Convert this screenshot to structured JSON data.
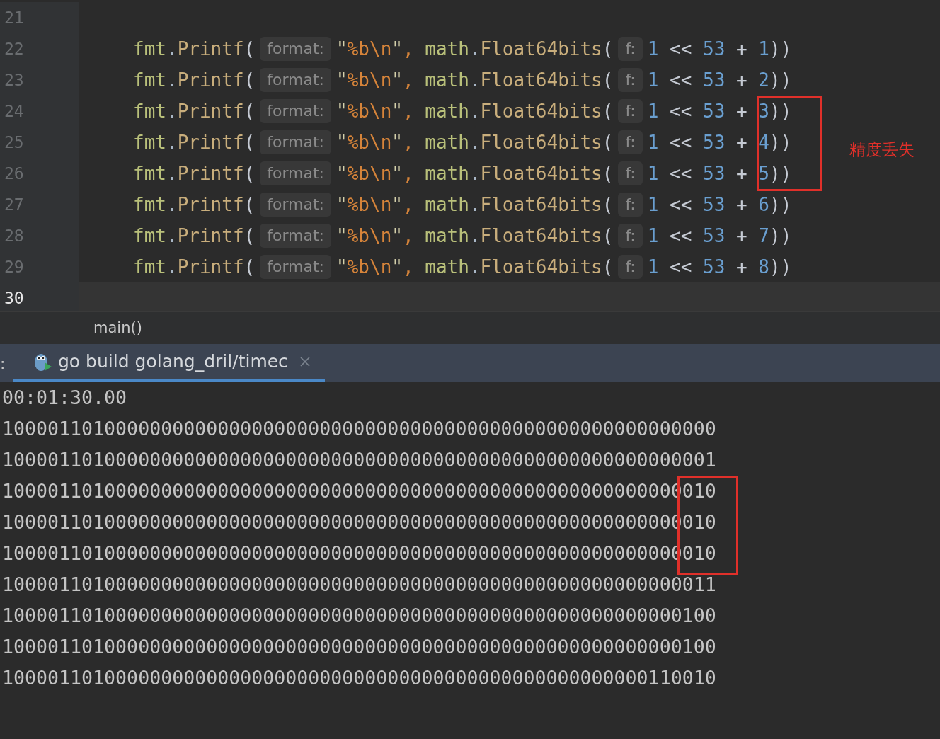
{
  "editor": {
    "code_lines": [
      {
        "number": "21",
        "current": false
      },
      {
        "number": "22",
        "current": false,
        "tokens": [
          {
            "kind": "pkg",
            "text": "fmt"
          },
          {
            "kind": "punct",
            "text": "."
          },
          {
            "kind": "func",
            "text": "Printf"
          },
          {
            "kind": "paren",
            "text": "("
          },
          {
            "kind": "hint",
            "text": "format:"
          },
          {
            "kind": "quote",
            "text": "\""
          },
          {
            "kind": "escape",
            "text": "%b\\n"
          },
          {
            "kind": "quote",
            "text": "\""
          },
          {
            "kind": "comma",
            "text": ", "
          },
          {
            "kind": "pkg",
            "text": "math"
          },
          {
            "kind": "punct",
            "text": "."
          },
          {
            "kind": "func",
            "text": "Float64bits"
          },
          {
            "kind": "paren",
            "text": "("
          },
          {
            "kind": "hint",
            "text": "f:"
          },
          {
            "kind": "number",
            "text": "1"
          },
          {
            "kind": "op",
            "text": " << "
          },
          {
            "kind": "number",
            "text": "53"
          },
          {
            "kind": "op",
            "text": " + "
          },
          {
            "kind": "number",
            "text": "1"
          },
          {
            "kind": "paren",
            "text": "))"
          }
        ]
      },
      {
        "number": "23",
        "current": false,
        "tokens": [
          {
            "kind": "pkg",
            "text": "fmt"
          },
          {
            "kind": "punct",
            "text": "."
          },
          {
            "kind": "func",
            "text": "Printf"
          },
          {
            "kind": "paren",
            "text": "("
          },
          {
            "kind": "hint",
            "text": "format:"
          },
          {
            "kind": "quote",
            "text": "\""
          },
          {
            "kind": "escape",
            "text": "%b\\n"
          },
          {
            "kind": "quote",
            "text": "\""
          },
          {
            "kind": "comma",
            "text": ", "
          },
          {
            "kind": "pkg",
            "text": "math"
          },
          {
            "kind": "punct",
            "text": "."
          },
          {
            "kind": "func",
            "text": "Float64bits"
          },
          {
            "kind": "paren",
            "text": "("
          },
          {
            "kind": "hint",
            "text": "f:"
          },
          {
            "kind": "number",
            "text": "1"
          },
          {
            "kind": "op",
            "text": " << "
          },
          {
            "kind": "number",
            "text": "53"
          },
          {
            "kind": "op",
            "text": " + "
          },
          {
            "kind": "number",
            "text": "2"
          },
          {
            "kind": "paren",
            "text": "))"
          }
        ]
      },
      {
        "number": "24",
        "current": false,
        "tokens": [
          {
            "kind": "pkg",
            "text": "fmt"
          },
          {
            "kind": "punct",
            "text": "."
          },
          {
            "kind": "func",
            "text": "Printf"
          },
          {
            "kind": "paren",
            "text": "("
          },
          {
            "kind": "hint",
            "text": "format:"
          },
          {
            "kind": "quote",
            "text": "\""
          },
          {
            "kind": "escape",
            "text": "%b\\n"
          },
          {
            "kind": "quote",
            "text": "\""
          },
          {
            "kind": "comma",
            "text": ", "
          },
          {
            "kind": "pkg",
            "text": "math"
          },
          {
            "kind": "punct",
            "text": "."
          },
          {
            "kind": "func",
            "text": "Float64bits"
          },
          {
            "kind": "paren",
            "text": "("
          },
          {
            "kind": "hint",
            "text": "f:"
          },
          {
            "kind": "number",
            "text": "1"
          },
          {
            "kind": "op",
            "text": " << "
          },
          {
            "kind": "number",
            "text": "53"
          },
          {
            "kind": "op",
            "text": " + "
          },
          {
            "kind": "number",
            "text": "3"
          },
          {
            "kind": "paren",
            "text": "))"
          }
        ]
      },
      {
        "number": "25",
        "current": false,
        "tokens": [
          {
            "kind": "pkg",
            "text": "fmt"
          },
          {
            "kind": "punct",
            "text": "."
          },
          {
            "kind": "func",
            "text": "Printf"
          },
          {
            "kind": "paren",
            "text": "("
          },
          {
            "kind": "hint",
            "text": "format:"
          },
          {
            "kind": "quote",
            "text": "\""
          },
          {
            "kind": "escape",
            "text": "%b\\n"
          },
          {
            "kind": "quote",
            "text": "\""
          },
          {
            "kind": "comma",
            "text": ", "
          },
          {
            "kind": "pkg",
            "text": "math"
          },
          {
            "kind": "punct",
            "text": "."
          },
          {
            "kind": "func",
            "text": "Float64bits"
          },
          {
            "kind": "paren",
            "text": "("
          },
          {
            "kind": "hint",
            "text": "f:"
          },
          {
            "kind": "number",
            "text": "1"
          },
          {
            "kind": "op",
            "text": " << "
          },
          {
            "kind": "number",
            "text": "53"
          },
          {
            "kind": "op",
            "text": " + "
          },
          {
            "kind": "number",
            "text": "4"
          },
          {
            "kind": "paren",
            "text": "))"
          }
        ]
      },
      {
        "number": "26",
        "current": false,
        "tokens": [
          {
            "kind": "pkg",
            "text": "fmt"
          },
          {
            "kind": "punct",
            "text": "."
          },
          {
            "kind": "func",
            "text": "Printf"
          },
          {
            "kind": "paren",
            "text": "("
          },
          {
            "kind": "hint",
            "text": "format:"
          },
          {
            "kind": "quote",
            "text": "\""
          },
          {
            "kind": "escape",
            "text": "%b\\n"
          },
          {
            "kind": "quote",
            "text": "\""
          },
          {
            "kind": "comma",
            "text": ", "
          },
          {
            "kind": "pkg",
            "text": "math"
          },
          {
            "kind": "punct",
            "text": "."
          },
          {
            "kind": "func",
            "text": "Float64bits"
          },
          {
            "kind": "paren",
            "text": "("
          },
          {
            "kind": "hint",
            "text": "f:"
          },
          {
            "kind": "number",
            "text": "1"
          },
          {
            "kind": "op",
            "text": " << "
          },
          {
            "kind": "number",
            "text": "53"
          },
          {
            "kind": "op",
            "text": " + "
          },
          {
            "kind": "number",
            "text": "5"
          },
          {
            "kind": "paren",
            "text": "))"
          }
        ]
      },
      {
        "number": "27",
        "current": false,
        "tokens": [
          {
            "kind": "pkg",
            "text": "fmt"
          },
          {
            "kind": "punct",
            "text": "."
          },
          {
            "kind": "func",
            "text": "Printf"
          },
          {
            "kind": "paren",
            "text": "("
          },
          {
            "kind": "hint",
            "text": "format:"
          },
          {
            "kind": "quote",
            "text": "\""
          },
          {
            "kind": "escape",
            "text": "%b\\n"
          },
          {
            "kind": "quote",
            "text": "\""
          },
          {
            "kind": "comma",
            "text": ", "
          },
          {
            "kind": "pkg",
            "text": "math"
          },
          {
            "kind": "punct",
            "text": "."
          },
          {
            "kind": "func",
            "text": "Float64bits"
          },
          {
            "kind": "paren",
            "text": "("
          },
          {
            "kind": "hint",
            "text": "f:"
          },
          {
            "kind": "number",
            "text": "1"
          },
          {
            "kind": "op",
            "text": " << "
          },
          {
            "kind": "number",
            "text": "53"
          },
          {
            "kind": "op",
            "text": " + "
          },
          {
            "kind": "number",
            "text": "6"
          },
          {
            "kind": "paren",
            "text": "))"
          }
        ]
      },
      {
        "number": "28",
        "current": false,
        "tokens": [
          {
            "kind": "pkg",
            "text": "fmt"
          },
          {
            "kind": "punct",
            "text": "."
          },
          {
            "kind": "func",
            "text": "Printf"
          },
          {
            "kind": "paren",
            "text": "("
          },
          {
            "kind": "hint",
            "text": "format:"
          },
          {
            "kind": "quote",
            "text": "\""
          },
          {
            "kind": "escape",
            "text": "%b\\n"
          },
          {
            "kind": "quote",
            "text": "\""
          },
          {
            "kind": "comma",
            "text": ", "
          },
          {
            "kind": "pkg",
            "text": "math"
          },
          {
            "kind": "punct",
            "text": "."
          },
          {
            "kind": "func",
            "text": "Float64bits"
          },
          {
            "kind": "paren",
            "text": "("
          },
          {
            "kind": "hint",
            "text": "f:"
          },
          {
            "kind": "number",
            "text": "1"
          },
          {
            "kind": "op",
            "text": " << "
          },
          {
            "kind": "number",
            "text": "53"
          },
          {
            "kind": "op",
            "text": " + "
          },
          {
            "kind": "number",
            "text": "7"
          },
          {
            "kind": "paren",
            "text": "))"
          }
        ]
      },
      {
        "number": "29",
        "current": false,
        "tokens": [
          {
            "kind": "pkg",
            "text": "fmt"
          },
          {
            "kind": "punct",
            "text": "."
          },
          {
            "kind": "func",
            "text": "Printf"
          },
          {
            "kind": "paren",
            "text": "("
          },
          {
            "kind": "hint",
            "text": "format:"
          },
          {
            "kind": "quote",
            "text": "\""
          },
          {
            "kind": "escape",
            "text": "%b\\n"
          },
          {
            "kind": "quote",
            "text": "\""
          },
          {
            "kind": "comma",
            "text": ", "
          },
          {
            "kind": "pkg",
            "text": "math"
          },
          {
            "kind": "punct",
            "text": "."
          },
          {
            "kind": "func",
            "text": "Float64bits"
          },
          {
            "kind": "paren",
            "text": "("
          },
          {
            "kind": "hint",
            "text": "f:"
          },
          {
            "kind": "number",
            "text": "1"
          },
          {
            "kind": "op",
            "text": " << "
          },
          {
            "kind": "number",
            "text": "53"
          },
          {
            "kind": "op",
            "text": " + "
          },
          {
            "kind": "number",
            "text": "8"
          },
          {
            "kind": "paren",
            "text": "))"
          }
        ]
      },
      {
        "number": "30",
        "current": true
      }
    ],
    "annotation": "精度丢失"
  },
  "breadcrumb": "main()",
  "run_panel": {
    "edge_label": ":",
    "tabs": [
      {
        "label": "go build golang_dril/timec",
        "selected": true
      }
    ],
    "output_lines": [
      "00:01:30.00",
      "100001101000000000000000000000000000000000000000000000000000000",
      "100001101000000000000000000000000000000000000000000000000000001",
      "100001101000000000000000000000000000000000000000000000000000010",
      "100001101000000000000000000000000000000000000000000000000000010",
      "100001101000000000000000000000000000000000000000000000000000010",
      "100001101000000000000000000000000000000000000000000000000000011",
      "100001101000000000000000000000000000000000000000000000000000100",
      "100001101000000000000000000000000000000000000000000000000000100",
      "100001101000000000000000000000000000000000000000000000000110010"
    ]
  }
}
